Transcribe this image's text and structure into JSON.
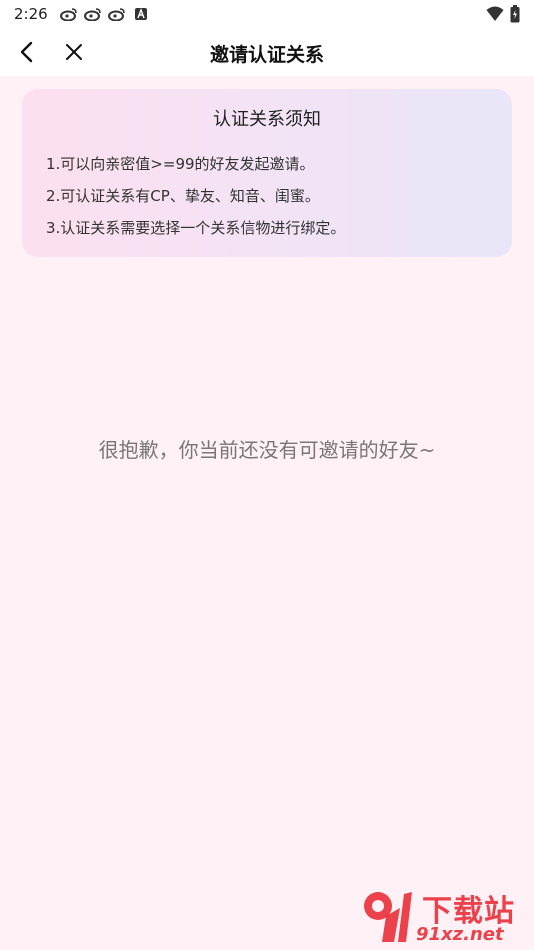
{
  "status_bar": {
    "time": "2:26",
    "icons": [
      "weibo-icon",
      "weibo-icon",
      "weibo-icon",
      "a-icon"
    ],
    "right_icons": [
      "wifi-icon",
      "battery-icon"
    ]
  },
  "header": {
    "title": "邀请认证关系",
    "back_icon": "chevron-left-icon",
    "close_icon": "close-icon"
  },
  "notice": {
    "title": "认证关系须知",
    "items": [
      "1.可以向亲密值>=99的好友发起邀请。",
      "2.可认证关系有CP、挚友、知音、闺蜜。",
      "3.认证关系需要选择一个关系信物进行绑定。"
    ]
  },
  "empty_state": {
    "message": "很抱歉，你当前还没有可邀请的好友~"
  },
  "watermark": {
    "brand": "下载站",
    "domain": "91xz.net"
  },
  "colors": {
    "page_bg": "#fff1f5",
    "card_gradient_start": "#fde0ef",
    "card_gradient_end": "#e8e6f8",
    "watermark_red": "#e8232e"
  }
}
